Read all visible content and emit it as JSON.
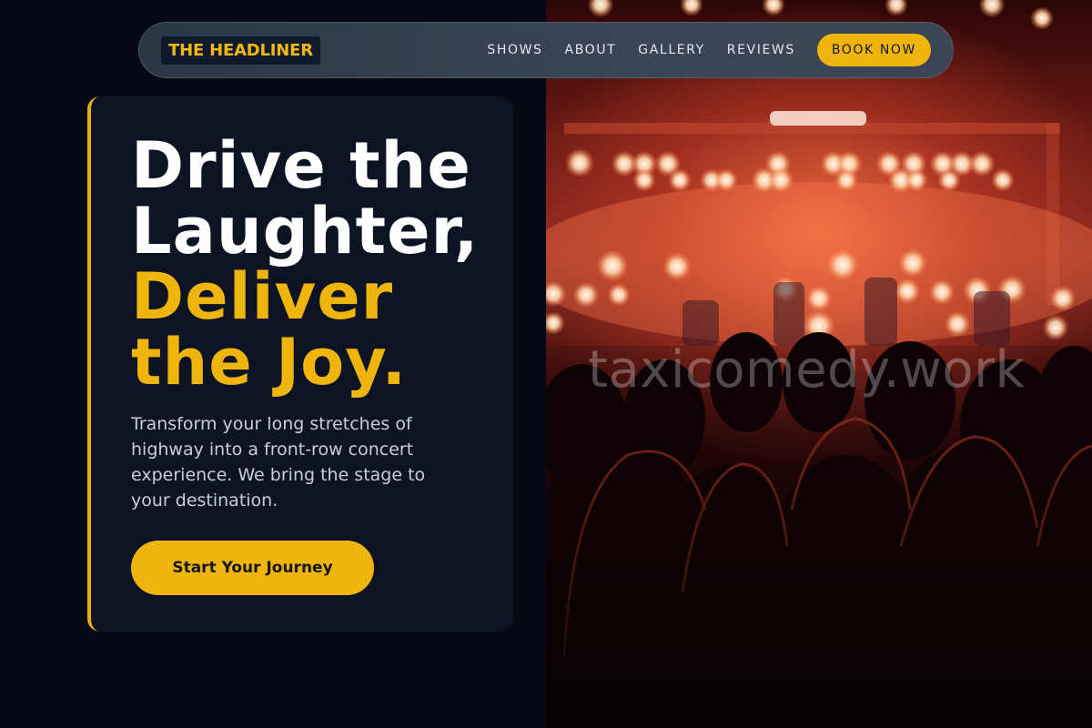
{
  "nav": {
    "logo": "THE HEADLINER",
    "links": [
      "SHOWS",
      "ABOUT",
      "GALLERY",
      "REVIEWS"
    ],
    "cta": "BOOK NOW"
  },
  "hero": {
    "headline_white_1": "Drive the",
    "headline_white_2": "Laughter,",
    "headline_gold_1": "Deliver",
    "headline_gold_2": "the Joy.",
    "subtext": "Transform your long stretches of highway into a front-row concert experience. We bring the stage to your destination.",
    "cta": "Start Your Journey"
  },
  "image": {
    "watermark": "taxicomedy.work"
  },
  "colors": {
    "accent": "#f0b50c",
    "background": "#050914",
    "card": "#0c1322"
  }
}
